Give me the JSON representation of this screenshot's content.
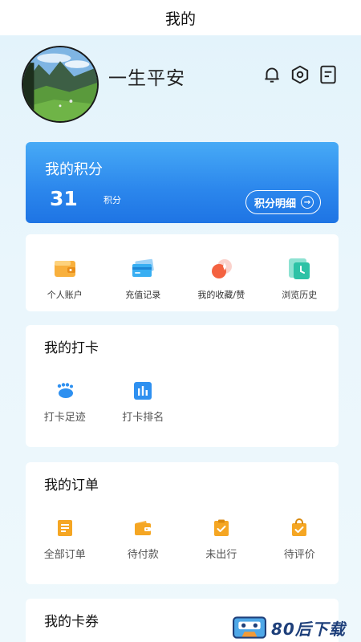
{
  "header": {
    "title": "我的"
  },
  "profile": {
    "username": "一生平安"
  },
  "points": {
    "title": "我的积分",
    "value": "31",
    "unit": "积分",
    "detail_label": "积分明细"
  },
  "shortcuts": [
    {
      "label": "个人账户",
      "icon": "wallet-icon"
    },
    {
      "label": "充值记录",
      "icon": "card-icon"
    },
    {
      "label": "我的收藏/赞",
      "icon": "favorite-icon"
    },
    {
      "label": "浏览历史",
      "icon": "history-icon"
    }
  ],
  "checkin": {
    "title": "我的打卡",
    "items": [
      {
        "label": "打卡足迹",
        "icon": "footprint-icon"
      },
      {
        "label": "打卡排名",
        "icon": "ranking-icon"
      }
    ]
  },
  "orders": {
    "title": "我的订单",
    "items": [
      {
        "label": "全部订单",
        "icon": "order-list-icon"
      },
      {
        "label": "待付款",
        "icon": "wallet-icon"
      },
      {
        "label": "未出行",
        "icon": "clipboard-check-icon"
      },
      {
        "label": "待评价",
        "icon": "bag-check-icon"
      }
    ]
  },
  "coupons": {
    "title": "我的卡券"
  },
  "watermark": {
    "text": "80后下载"
  },
  "colors": {
    "accent": "#2b86ec",
    "orange": "#f5a623",
    "bg": "#e6f4fb"
  }
}
